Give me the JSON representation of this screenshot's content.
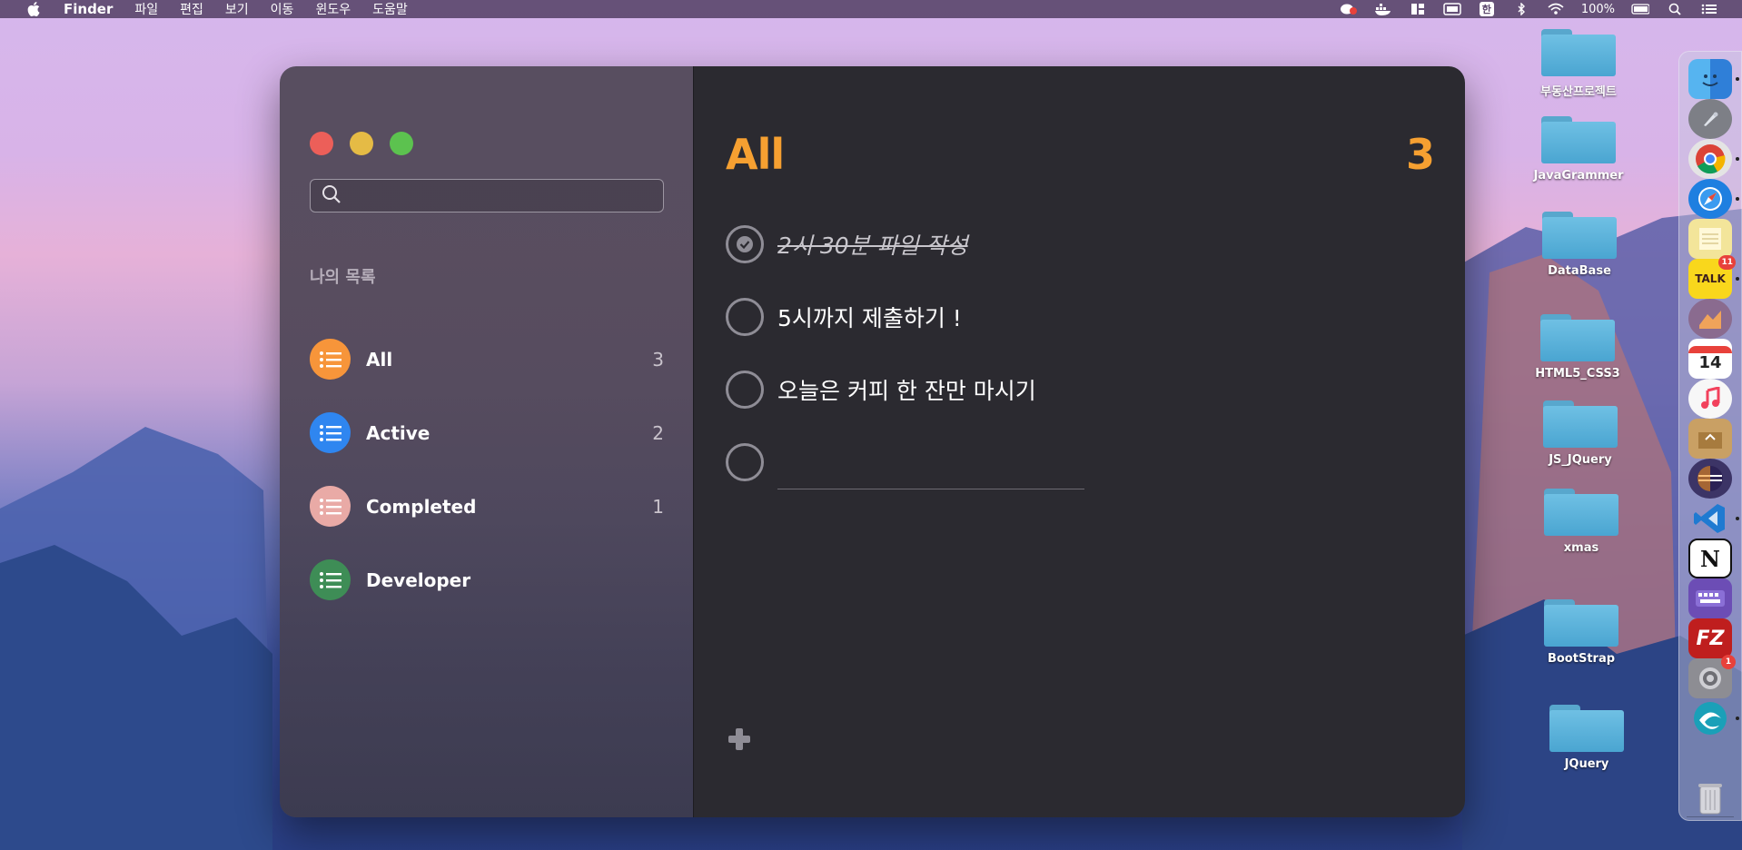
{
  "menubar": {
    "app_name": "Finder",
    "items": [
      "파일",
      "편집",
      "보기",
      "이동",
      "윈도우",
      "도움말"
    ],
    "battery": "100%",
    "input_method": "한"
  },
  "sidebar": {
    "search_placeholder": "",
    "section_title": "나의 목록",
    "lists": [
      {
        "name": "All",
        "count": "3",
        "color": "#f7953a"
      },
      {
        "name": "Active",
        "count": "2",
        "color": "#2f86f0"
      },
      {
        "name": "Completed",
        "count": "1",
        "color": "#e9aaa6"
      },
      {
        "name": "Developer",
        "count": "",
        "color": "#3e8d56"
      }
    ]
  },
  "main": {
    "title": "All",
    "count": "3",
    "todos": [
      {
        "text": "2시 30분 파일 작성",
        "done": true
      },
      {
        "text": "5시까지 제출하기 !",
        "done": false
      },
      {
        "text": "오늘은 커피 한 잔만 마시기",
        "done": false
      }
    ],
    "new_todo_value": ""
  },
  "desktop": {
    "folders": [
      "부동산프로젝트",
      "JavaGrammer",
      "DataBase",
      "HTML5_CSS3",
      "JS_JQuery",
      "xmas",
      "BootStrap",
      "JQuery"
    ]
  },
  "dock": {
    "apps": [
      {
        "name": "finder",
        "label": "",
        "color": "#3a8ee6",
        "badge": ""
      },
      {
        "name": "launchpad",
        "label": "",
        "color": "#7d7f86",
        "badge": ""
      },
      {
        "name": "chrome",
        "label": "",
        "color": "#e4e4e4",
        "badge": ""
      },
      {
        "name": "safari",
        "label": "",
        "color": "#1e7fe0",
        "badge": ""
      },
      {
        "name": "notes",
        "label": "",
        "color": "#f3e59a",
        "badge": ""
      },
      {
        "name": "kakaotalk",
        "label": "TALK",
        "color": "#f9d71c",
        "badge": "11"
      },
      {
        "name": "macos-installer",
        "label": "",
        "color": "#8a6b8f",
        "badge": ""
      },
      {
        "name": "calendar",
        "label": "14",
        "color": "#ffffff",
        "badge": ""
      },
      {
        "name": "music",
        "label": "",
        "color": "#f7f7f7",
        "badge": ""
      },
      {
        "name": "archive-utility",
        "label": "",
        "color": "#c9a064",
        "badge": ""
      },
      {
        "name": "eclipse",
        "label": "",
        "color": "#3c3466",
        "badge": ""
      },
      {
        "name": "vscode",
        "label": "",
        "color": "#1f7ad1",
        "badge": ""
      },
      {
        "name": "notion",
        "label": "N",
        "color": "#ffffff",
        "badge": ""
      },
      {
        "name": "keyboard-app",
        "label": "",
        "color": "#6c4db5",
        "badge": ""
      },
      {
        "name": "filezilla",
        "label": "FZ",
        "color": "#bf1e1e",
        "badge": ""
      },
      {
        "name": "system-preferences",
        "label": "",
        "color": "#8d8d93",
        "badge": "1"
      },
      {
        "name": "edge-app",
        "label": "",
        "color": "#1aa0b8",
        "badge": ""
      },
      {
        "name": "trash",
        "label": "",
        "color": "#b8b8c0",
        "badge": ""
      }
    ]
  }
}
